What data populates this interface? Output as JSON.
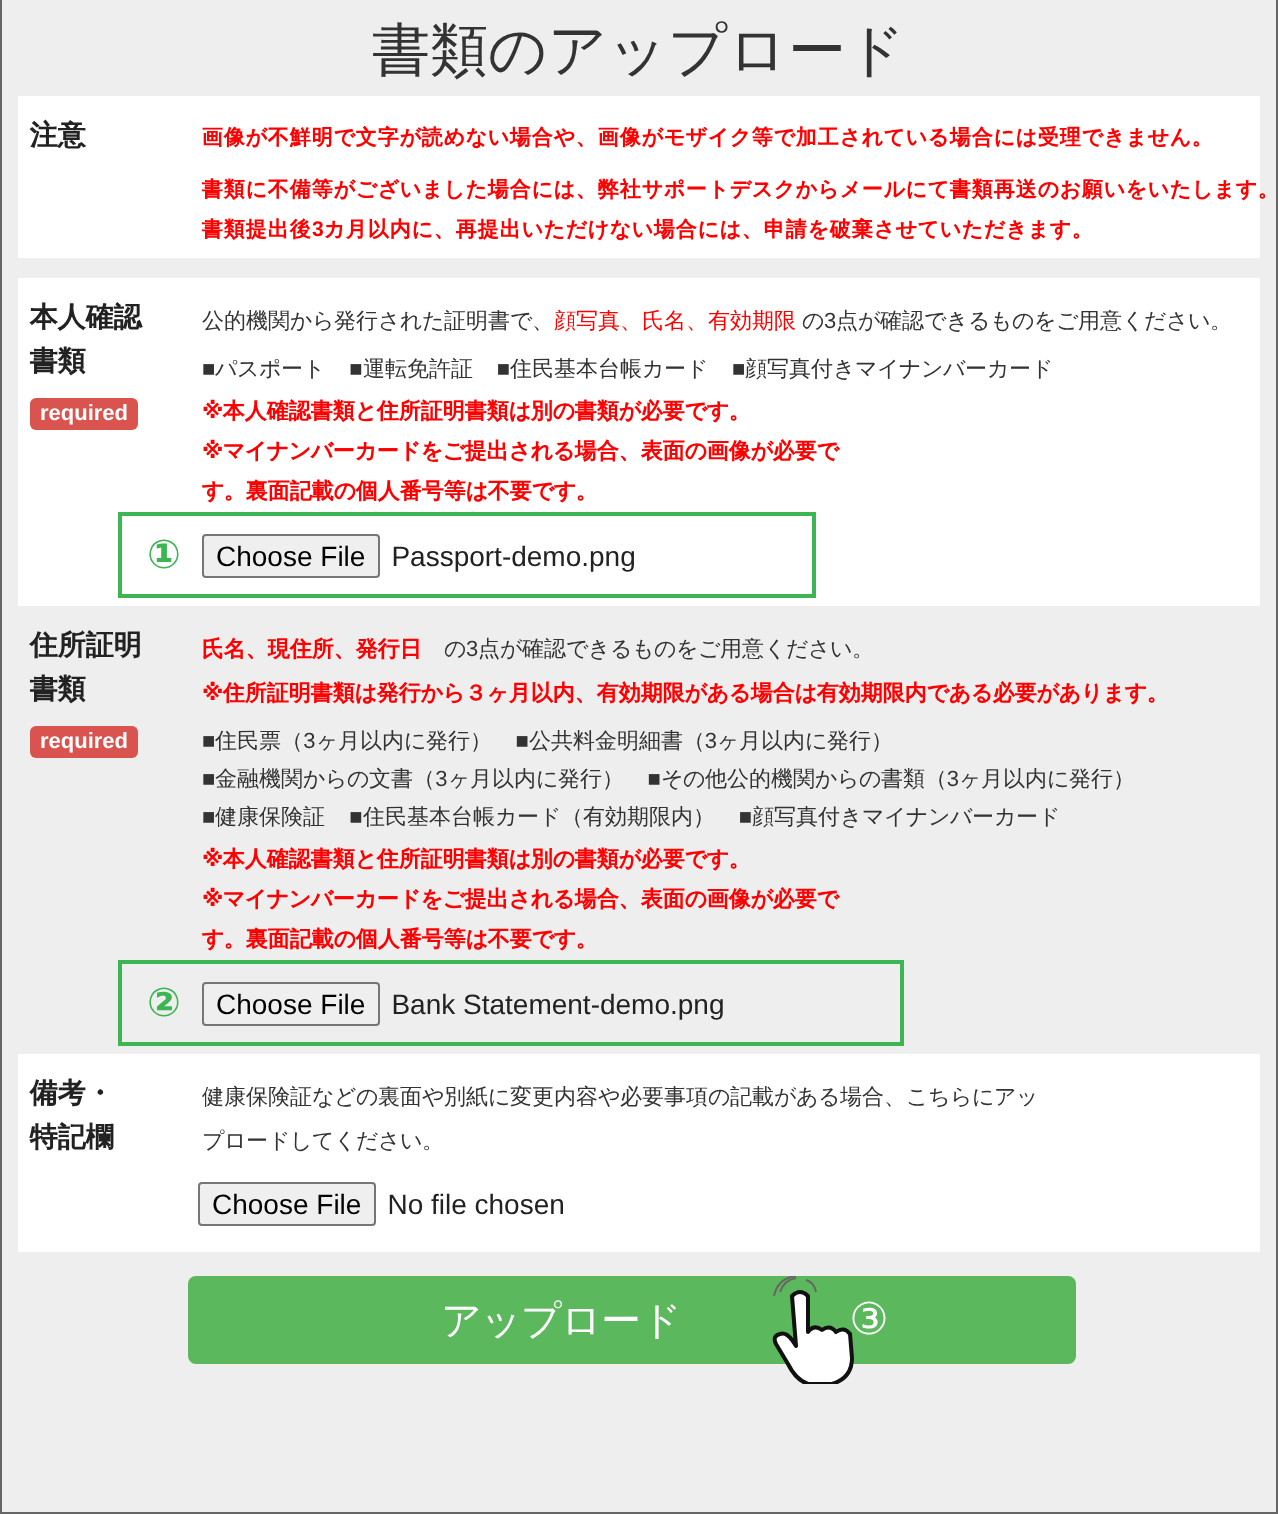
{
  "title": "書類のアップロード",
  "sections": [
    {
      "kind": "notice",
      "label": "注意",
      "shaded": false,
      "lines": [
        "画像が不鮮明で文字が読めない場合や、画像がモザイク等で加工されている場合には受理できません。",
        "書類に不備等がございました場合には、弊社サポートデスクからメールにて書類再送のお願いをいたします。",
        "書類提出後3カ月以内に、再提出いただけない場合には、申請を破棄させていただきます。"
      ]
    },
    {
      "kind": "upload",
      "label": "本人確認書類",
      "required": "required",
      "shaded": false,
      "intro": [
        {
          "text": "公的機関から発行された証明書で、",
          "emphasis": false
        },
        {
          "text": "顔写真、氏名、有効期限",
          "emphasis": true
        },
        {
          "text": " の3点が確認できるものをご用意ください。",
          "emphasis": false
        }
      ],
      "documents": [
        [
          "■パスポート",
          "■運転免許証",
          "■住民基本台帳カード",
          "■顔写真付きマイナンバーカード"
        ]
      ],
      "warnings": [
        "※本人確認書類と住所証明書類は別の書類が必要です。",
        "※マイナンバーカードをご提出される場合、表面の画像が必要です。裏面記載の個人番号等は不要です。"
      ],
      "file": {
        "marker": "①",
        "button": "Choose File",
        "file_name": "Passport-demo.png",
        "highlighted": true
      }
    },
    {
      "kind": "upload",
      "label": "住所証明書類",
      "required": "required",
      "shaded": true,
      "intro": [
        {
          "text": "**氏名、現住所、発行日**",
          "emphasis": true
        },
        {
          "text": "　の3点が確認できるものをご用意ください。",
          "emphasis": false
        }
      ],
      "conditions": [
        "※住所証明書類は発行から３ヶ月以内、有効期限がある場合は有効期限内である必要があります。"
      ],
      "documents": [
        [
          "■住民票（3ヶ月以内に発行）",
          "■公共料金明細書（3ヶ月以内に発行）"
        ],
        [
          "■金融機関からの文書（3ヶ月以内に発行）",
          "■その他公的機関からの書類（3ヶ月以内に発行）"
        ],
        [
          "■健康保険証",
          "■住民基本台帳カード（有効期限内）",
          "■顔写真付きマイナンバーカード"
        ]
      ],
      "warnings": [
        "※本人確認書類と住所証明書類は別の書類が必要です。",
        "※マイナンバーカードをご提出される場合、表面の画像が必要です。裏面記載の個人番号等は不要です。"
      ],
      "file": {
        "marker": "②",
        "button": "Choose File",
        "file_name": "Bank Statement-demo.png",
        "highlighted": true
      }
    },
    {
      "kind": "remarks",
      "label": "備考・特記欄",
      "shaded": false,
      "note": "健康保険証などの裏面や別紙に変更内容や必要事項の記載がある場合、こちらにアップロードしてください。",
      "file": {
        "button": "Choose File",
        "file_name": "No file chosen",
        "highlighted": false
      }
    }
  ],
  "upload_button": {
    "label": "アップロード",
    "marker": "③"
  }
}
